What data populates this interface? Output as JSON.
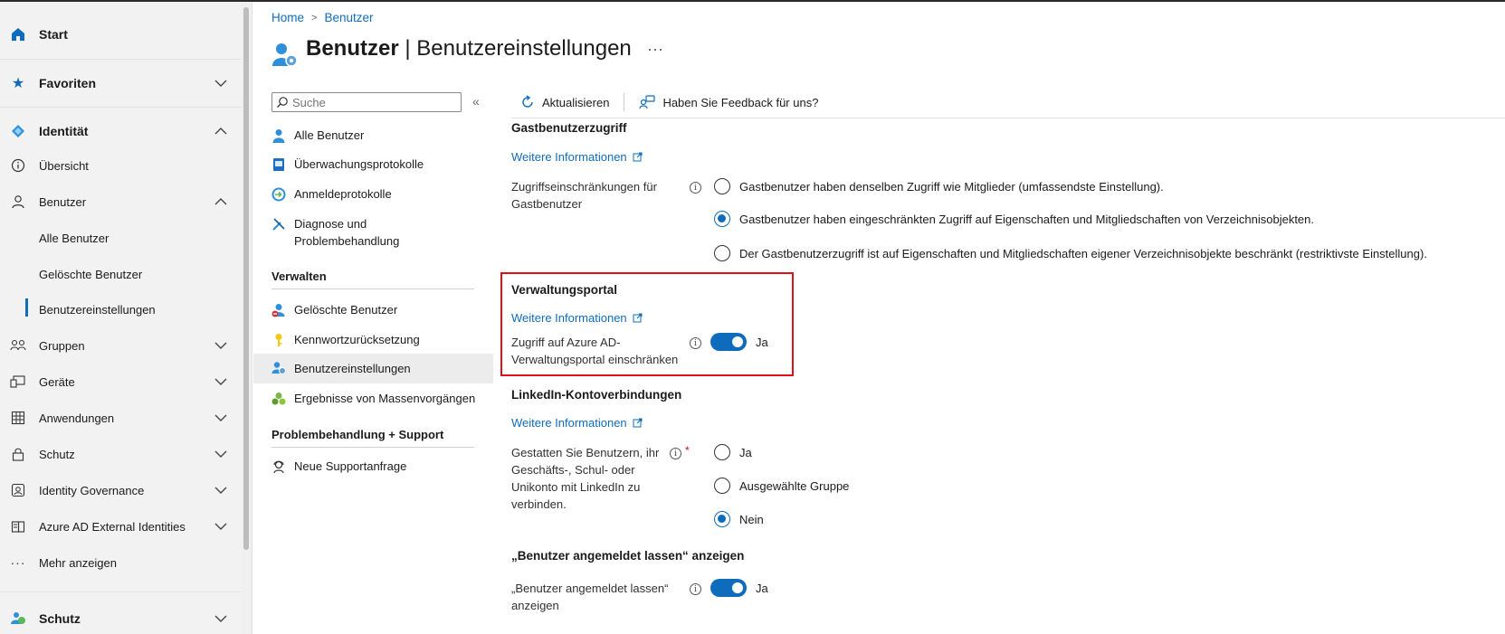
{
  "leftnav": {
    "start": "Start",
    "favoriten": "Favoriten",
    "identitaet": "Identität",
    "uebersicht": "Übersicht",
    "benutzer": "Benutzer",
    "alle_benutzer": "Alle Benutzer",
    "geloeschte_benutzer": "Gelöschte Benutzer",
    "benutzereinstellungen": "Benutzereinstellungen",
    "gruppen": "Gruppen",
    "geraete": "Geräte",
    "anwendungen": "Anwendungen",
    "schutz": "Schutz",
    "identity_governance": "Identity Governance",
    "external_identities": "Azure AD External Identities",
    "mehr_anzeigen": "Mehr anzeigen",
    "schutz_bottom": "Schutz"
  },
  "breadcrumb": {
    "home": "Home",
    "benutzer": "Benutzer"
  },
  "header": {
    "title_bold": "Benutzer",
    "separator": " | ",
    "title_rest": "Benutzereinstellungen",
    "more": "···"
  },
  "menu": {
    "search_placeholder": "Suche",
    "collapse": "«",
    "items": [
      "Alle Benutzer",
      "Überwachungsprotokolle",
      "Anmeldeprotokolle",
      "Diagnose und",
      "Problembehandlung"
    ],
    "verwalten_head": "Verwalten",
    "verwalten_items": [
      "Gelöschte Benutzer",
      "Kennwortzurücksetzung",
      "Benutzereinstellungen",
      "Ergebnisse von Massenvorgängen"
    ],
    "support_head": "Problembehandlung + Support",
    "support_items": [
      "Neue Supportanfrage"
    ]
  },
  "toolbar": {
    "refresh": "Aktualisieren",
    "feedback": "Haben Sie Feedback für uns?"
  },
  "sections": {
    "guest": {
      "title": "Gastbenutzerzugriff",
      "link": "Weitere Informationen",
      "label_line1": "Zugriffseinschränkungen für",
      "label_line2": "Gastbenutzer",
      "options": [
        "Gastbenutzer haben denselben Zugriff wie Mitglieder (umfassendste Einstellung).",
        "Gastbenutzer haben eingeschränkten Zugriff auf Eigenschaften und Mitgliedschaften von Verzeichnisobjekten.",
        "Der Gastbenutzerzugriff ist auf Eigenschaften und Mitgliedschaften eigener Verzeichnisobjekte beschränkt (restriktivste Einstellung)."
      ],
      "selected_index": 1
    },
    "portal": {
      "title": "Verwaltungsportal",
      "link": "Weitere Informationen",
      "label_line1": "Zugriff auf Azure AD-",
      "label_line2": "Verwaltungsportal einschränken",
      "toggle_label": "Ja"
    },
    "linkedin": {
      "title": "LinkedIn-Kontoverbindungen",
      "link": "Weitere Informationen",
      "label_lines": [
        "Gestatten Sie Benutzern, ihr",
        "Geschäfts-, Schul- oder",
        "Unikonto mit LinkedIn zu",
        "verbinden."
      ],
      "required": "*",
      "options": [
        "Ja",
        "Ausgewählte Gruppe",
        "Nein"
      ],
      "selected_index": 2
    },
    "stay_signed_in": {
      "title": "„Benutzer angemeldet lassen“ anzeigen",
      "label_line1": "„Benutzer angemeldet lassen“",
      "label_line2": "anzeigen",
      "toggle_label": "Ja"
    }
  },
  "colors": {
    "accent": "#0f6cbd",
    "highlight": "#e0101a",
    "nav_bg": "#f2f2f2"
  }
}
